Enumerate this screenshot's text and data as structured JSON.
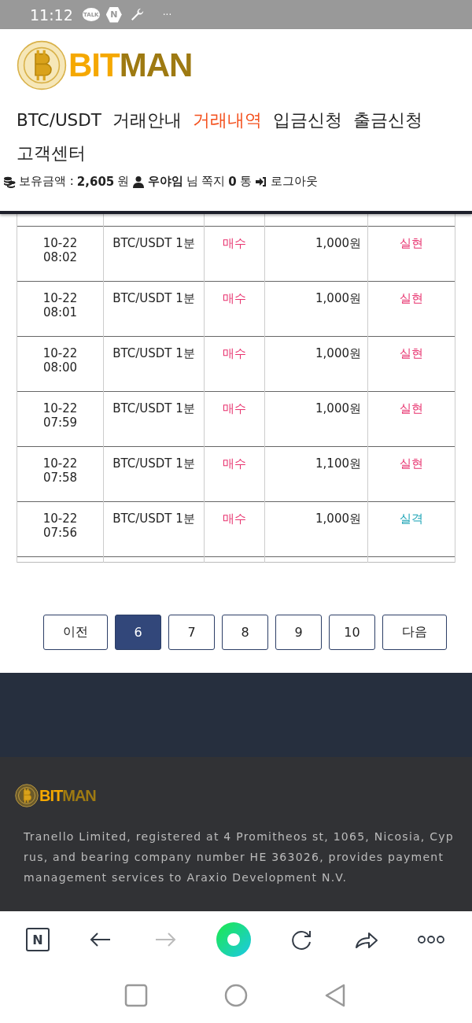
{
  "status_bar": {
    "time": "11:12",
    "talk": "TALK",
    "n_badge": "N",
    "more": "···"
  },
  "header": {
    "logo_parts": [
      "BIT",
      "MAN"
    ],
    "nav": [
      {
        "label": "BTC/USDT",
        "selected": false
      },
      {
        "label": "거래안내",
        "selected": false
      },
      {
        "label": "거래내역",
        "selected": true
      },
      {
        "label": "입금신청",
        "selected": false
      },
      {
        "label": "출금신청",
        "selected": false
      },
      {
        "label": "고객센터",
        "selected": false
      }
    ],
    "account": {
      "balance_label": "보유금액 :",
      "balance": "2,605",
      "balance_unit": "원",
      "user": "우야임",
      "user_suffix": "님",
      "messages_label": "쪽지",
      "messages": "0",
      "messages_unit": "통",
      "logout": "로그아웃"
    }
  },
  "table": {
    "rows": [
      {
        "date": "10-22",
        "time": "08:02",
        "market": "BTC/USDT 1분",
        "side": "매수",
        "amount": "1,000원",
        "result": "실현",
        "kind": "win"
      },
      {
        "date": "10-22",
        "time": "08:01",
        "market": "BTC/USDT 1분",
        "side": "매수",
        "amount": "1,000원",
        "result": "실현",
        "kind": "win"
      },
      {
        "date": "10-22",
        "time": "08:00",
        "market": "BTC/USDT 1분",
        "side": "매수",
        "amount": "1,000원",
        "result": "실현",
        "kind": "win"
      },
      {
        "date": "10-22",
        "time": "07:59",
        "market": "BTC/USDT 1분",
        "side": "매수",
        "amount": "1,000원",
        "result": "실현",
        "kind": "win"
      },
      {
        "date": "10-22",
        "time": "07:58",
        "market": "BTC/USDT 1분",
        "side": "매수",
        "amount": "1,100원",
        "result": "실현",
        "kind": "win"
      },
      {
        "date": "10-22",
        "time": "07:56",
        "market": "BTC/USDT 1분",
        "side": "매수",
        "amount": "1,000원",
        "result": "실격",
        "kind": "fail"
      }
    ]
  },
  "pagination": [
    {
      "label": "이전",
      "selected": false
    },
    {
      "label": "6",
      "selected": true
    },
    {
      "label": "7",
      "selected": false
    },
    {
      "label": "8",
      "selected": false
    },
    {
      "label": "9",
      "selected": false
    },
    {
      "label": "10",
      "selected": false
    },
    {
      "label": "다음",
      "selected": false
    }
  ],
  "footer": {
    "logo_parts": [
      "BIT",
      "MAN"
    ],
    "text": "Tranello Limited, registered at 4 Promitheos st, 1065, Nicosia, Cyprus, and bearing company number HE 363026, provides payment management services to Araxio Development N.V."
  },
  "browser_bar": {
    "logo": "N"
  }
}
